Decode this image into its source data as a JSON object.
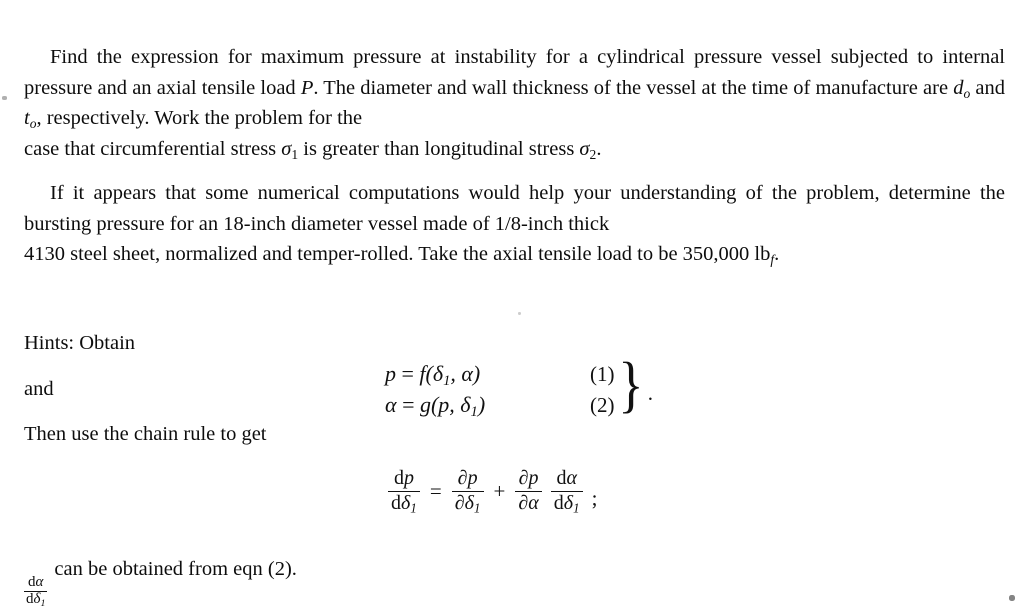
{
  "document": {
    "type": "textbook-problem-statement",
    "background_color": "#ffffff",
    "text_color": "#0d0d0d"
  },
  "paragraphs": [
    {
      "id": "problem-statement",
      "line1": "Find the expression for maximum pressure at instability for a cylindrical pressure vessel",
      "line2_a": "subjected to internal pressure and an axial tensile load ",
      "line2_sym": "P",
      "line2_b": ".  The diameter and wall thickness of",
      "line3_a": "the vessel at the time of manufacture are ",
      "line3_sym1": "d",
      "line3_sym1_sub": "o",
      "line3_b": " and ",
      "line3_sym2": "t",
      "line3_sym2_sub": "o",
      "line3_c": ", respectively.  Work the problem for the",
      "line4_a": "case that circumferential stress ",
      "line4_sym1": "σ",
      "line4_sym1_sub": "1",
      "line4_b": " is greater than longitudinal stress ",
      "line4_sym2": "σ",
      "line4_sym2_sub": "2",
      "line4_c": "."
    },
    {
      "id": "numerical-computation-note",
      "line1": "If it appears that some numerical computations would help your understanding of the",
      "line2": "problem, determine the bursting pressure for an 18-inch diameter vessel made of 1/8-inch thick",
      "line3_a": "4130 steel sheet, normalized and temper-rolled.  Take the axial tensile load to be 350,000 lb",
      "line3_sub": "f",
      "line3_b": "."
    }
  ],
  "hints": {
    "label": "Hints:  Obtain",
    "and_label": "and",
    "chain_rule_label": "Then use the chain rule to get",
    "equations": [
      {
        "lhs": "p",
        "rel": " = ",
        "rhs": "f(δ",
        "rhs_sub": "1",
        "rhs_tail": ", α)",
        "number": "(1)"
      },
      {
        "lhs": "α",
        "rel": " = ",
        "rhs": "g(p, δ",
        "rhs_sub": "1",
        "rhs_tail": ")",
        "number": "(2)"
      }
    ],
    "brace_glyph": "}",
    "brace_trailing_punctuation": "."
  },
  "chain_rule_equation": {
    "term1": {
      "numerator_d": "d",
      "numerator_var": "p",
      "denominator_d": "d",
      "denominator_var": "δ",
      "denominator_sub": "1"
    },
    "equals": "=",
    "term2": {
      "numerator_d": "∂",
      "numerator_var": "p",
      "denominator_d": "∂",
      "denominator_var": "δ",
      "denominator_sub": "1"
    },
    "plus": "+",
    "term3": {
      "numerator_d": "∂",
      "numerator_var": "p",
      "denominator_d": "∂",
      "denominator_var": "α",
      "denominator_sub": ""
    },
    "term4": {
      "numerator_d": "d",
      "numerator_var": "α",
      "denominator_d": "d",
      "denominator_var": "δ",
      "denominator_sub": "1"
    },
    "terminator": ";"
  },
  "closing_line": {
    "fraction": {
      "numerator_d": "d",
      "numerator_var": "α",
      "denominator_d": "d",
      "denominator_var": "δ",
      "denominator_sub": "1"
    },
    "text": "can be obtained from eqn (2)."
  }
}
